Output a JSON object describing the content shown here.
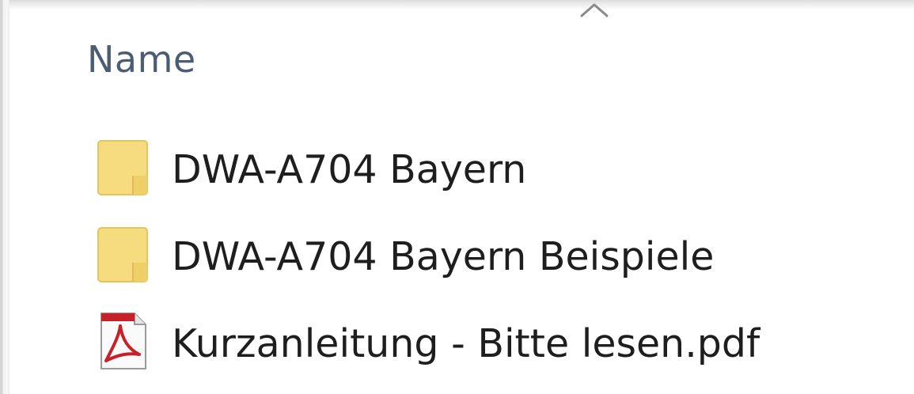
{
  "column_header": {
    "name_label": "Name",
    "sort_icon": "chevron-up-icon"
  },
  "files": [
    {
      "name": "DWA-A704 Bayern",
      "type": "folder",
      "icon": "folder-icon"
    },
    {
      "name": "DWA-A704 Bayern Beispiele",
      "type": "folder",
      "icon": "folder-icon"
    },
    {
      "name": "Kurzanleitung - Bitte lesen.pdf",
      "type": "pdf",
      "icon": "pdf-file-icon"
    }
  ],
  "colors": {
    "header_text": "#4b5d72",
    "file_text": "#1e1e1e",
    "folder_yellow": "#f6dc7e",
    "pdf_red": "#c8202a"
  }
}
